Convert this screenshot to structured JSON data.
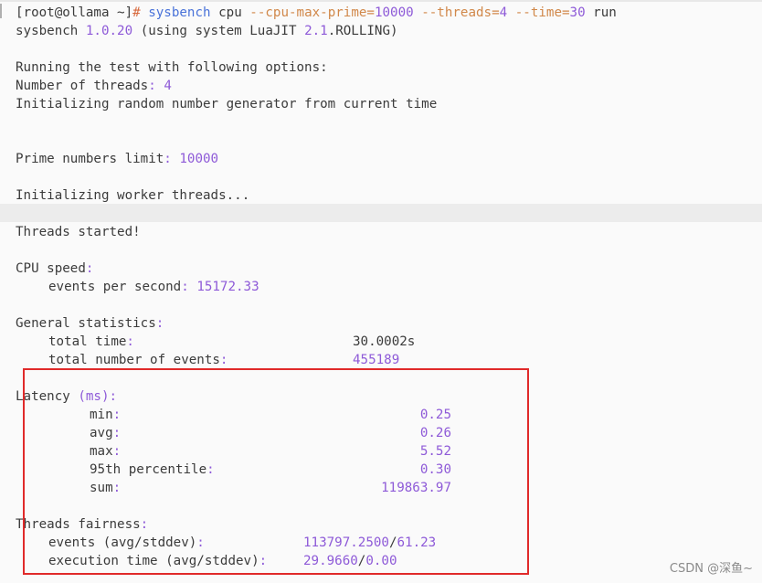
{
  "terminal": {
    "prompt": {
      "user_host": "[root@ollama ~]",
      "hash": "#",
      "command": "sysbench",
      "arg_cpu": "cpu",
      "flag1": "--cpu-max-prime=",
      "flag1_val": "10000",
      "flag2": "--threads=",
      "flag2_val": "4",
      "flag3": "--time=",
      "flag3_val": "30",
      "arg_run": "run"
    },
    "version_line": {
      "name": "sysbench",
      "version": "1.0.20",
      "rest_open": "(using system LuaJIT ",
      "lua_ver": "2.1",
      "rest_close": ".ROLLING)"
    },
    "options_header": "Running the test with following options:",
    "threads_label": "Number of threads",
    "threads_value": "4",
    "rng_line": "Initializing random number generator from current time",
    "prime_label": "Prime numbers limit",
    "prime_value": "10000",
    "worker_line": "Initializing worker threads...",
    "started_line": "Threads started!",
    "cpu_speed_label": "CPU speed",
    "eps_label": "events per second",
    "eps_value": "15172.33",
    "general_label": "General statistics",
    "total_time_label": "total time",
    "total_time_value": "30.0002s",
    "total_events_label": "total number of events",
    "total_events_value": "455189",
    "latency_label": "Latency",
    "latency_unit": "(ms)",
    "latency": [
      {
        "label": "min",
        "value": "0.25"
      },
      {
        "label": "avg",
        "value": "0.26"
      },
      {
        "label": "max",
        "value": "5.52"
      },
      {
        "label": "95th percentile",
        "value": "0.30"
      },
      {
        "label": "sum",
        "value": "119863.97"
      }
    ],
    "fairness_label": "Threads fairness",
    "fair_events_label": "events (avg/stddev)",
    "fair_events_avg": "113797.2500",
    "fair_events_std": "61.23",
    "fair_exec_label": "execution time (avg/stddev)",
    "fair_exec_avg": "29.9660",
    "fair_exec_std": "0.00",
    "colon": ":",
    "slash": "/"
  },
  "watermark": "CSDN @深鱼~",
  "colors": {
    "number": "#8e5ad8",
    "command": "#4a73d9",
    "flag": "#d1884a",
    "highlight_box": "#e02a2a",
    "background": "#fafafa"
  }
}
